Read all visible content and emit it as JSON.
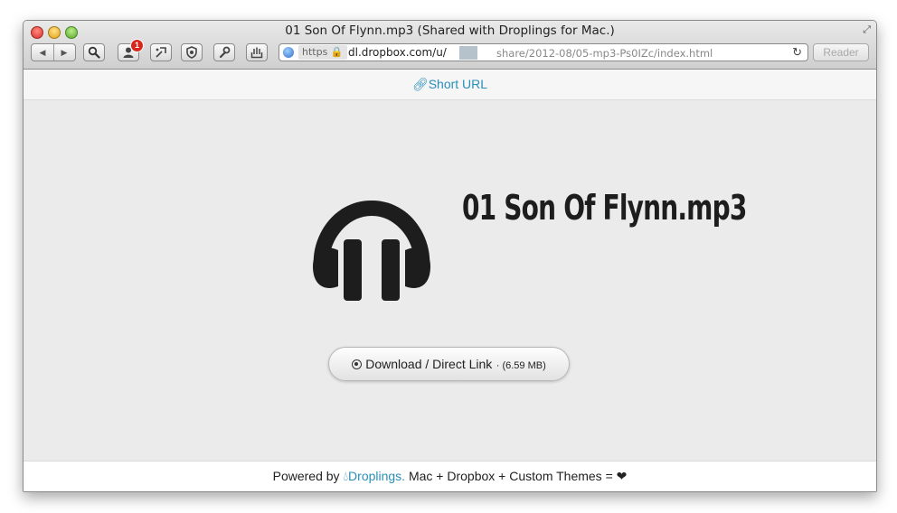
{
  "window": {
    "title": "01 Son Of Flynn.mp3 (Shared with Droplings for Mac.)"
  },
  "toolbar": {
    "back_icon": "◀",
    "forward_icon": "▶",
    "extension_badge": "1",
    "reader_label": "Reader"
  },
  "address_bar": {
    "scheme": "https",
    "host": "dl.dropbox.com/u/",
    "path": "share/2012-08/05-mp3-Ps0IZc/index.html"
  },
  "page": {
    "short_url_label": "Short URL",
    "file_title": "01 Son Of Flynn.mp3",
    "download_label": "Download / Direct Link",
    "download_size": "· (6.59 MB)",
    "footer": {
      "prefix": "Powered by ",
      "link_label": "Droplings.",
      "suffix": " Mac + Dropbox + Custom Themes = "
    }
  },
  "colors": {
    "accent_link": "#2a8fb8",
    "icon_dark": "#1d1d1d"
  }
}
